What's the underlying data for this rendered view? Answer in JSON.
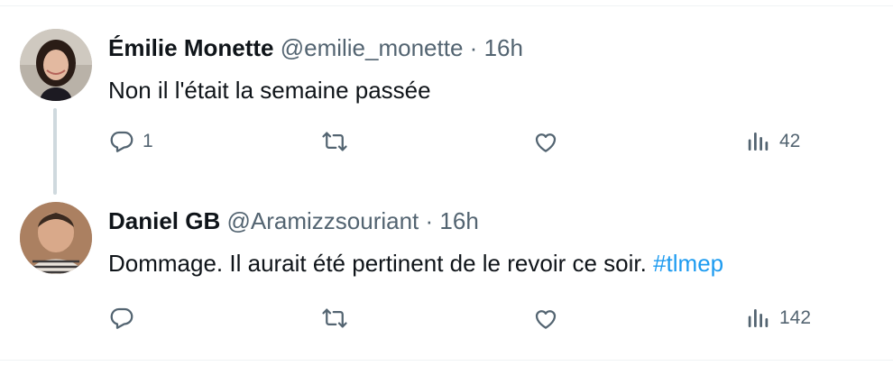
{
  "tweets": [
    {
      "name": "Émilie Monette",
      "handle": "@emilie_monette",
      "separator": "·",
      "time": "16h",
      "text": "Non il l'était la semaine passée",
      "hashtag": "",
      "actions": {
        "replies": "1",
        "retweets": "",
        "likes": "",
        "views": "42"
      }
    },
    {
      "name": "Daniel GB",
      "handle": "@Aramizzsouriant",
      "separator": "·",
      "time": "16h",
      "text": "Dommage. Il aurait été pertinent de le revoir ce soir. ",
      "hashtag": "#tlmep",
      "actions": {
        "replies": "",
        "retweets": "",
        "likes": "",
        "views": "142"
      }
    }
  ],
  "colors": {
    "secondary": "#536471",
    "link": "#1d9bf0",
    "thread": "#cfd9de"
  }
}
